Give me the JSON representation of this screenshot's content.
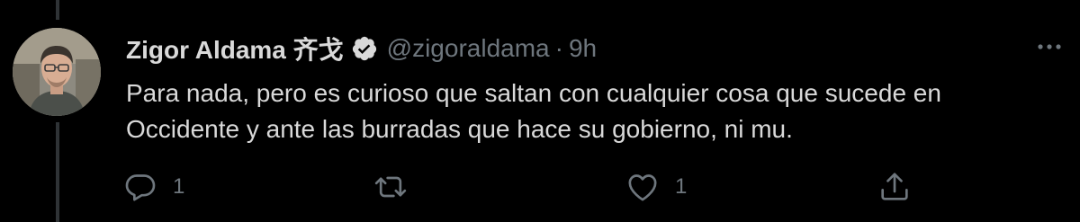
{
  "tweet": {
    "display_name": "Zigor Aldama 齐戈",
    "handle": "@zigoraldama",
    "separator": "·",
    "timestamp": "9h",
    "text_lines": [
      "Para nada, pero es curioso que saltan con cualquier cosa que sucede en",
      "Occidente y ante las burradas que hace su gobierno, ni mu."
    ]
  },
  "actions": {
    "reply_count": "1",
    "retweet_count": "",
    "like_count": "1"
  },
  "icons": {
    "verified": "verified-badge-icon",
    "more": "more-options-icon",
    "reply": "reply-icon",
    "retweet": "retweet-icon",
    "like": "heart-icon",
    "share": "share-icon"
  },
  "colors": {
    "background": "#000000",
    "text_primary": "#d9d9d9",
    "text_secondary": "#6e767d",
    "thread_line": "#2f3336"
  }
}
